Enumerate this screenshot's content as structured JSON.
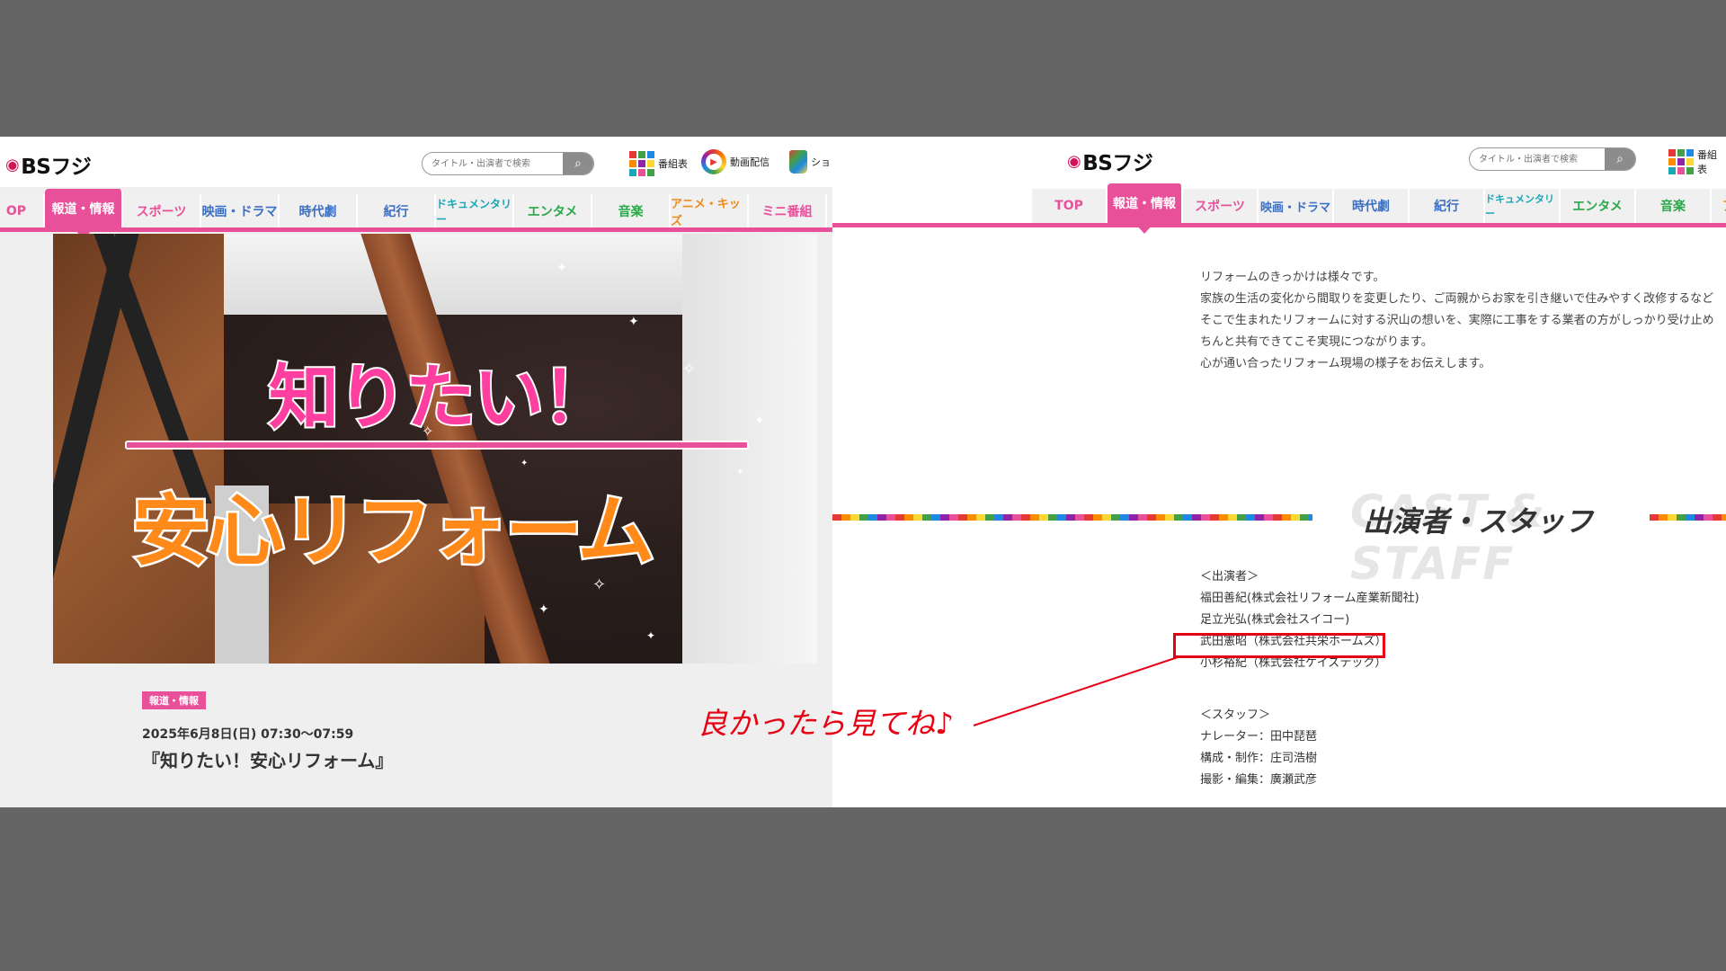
{
  "left": {
    "logo": "BSフジ",
    "search_placeholder": "タイトル・出演者で検索",
    "header_links": [
      "番組表",
      "動画配信",
      "ショ"
    ],
    "nav_tabs": [
      "OP",
      "報道・情報",
      "スポーツ",
      "映画・ドラマ",
      "時代劇",
      "紀行",
      "ドキュメンタリー",
      "エンタメ",
      "音楽",
      "アニメ・キッズ",
      "ミニ番組"
    ],
    "nav_colors": [
      "#e8519a",
      "#ffffff",
      "#e8519a",
      "#3b6fc4",
      "#3b6fc4",
      "#3b6fc4",
      "#1aa6b7",
      "#2aa84a",
      "#2aa84a",
      "#f08a1c",
      "#e8519a"
    ],
    "hero_title_1": "知りたい！",
    "hero_title_2": "安心リフォーム",
    "category_badge": "報道・情報",
    "air_date": "2025年6月8日(日) 07:30〜07:59",
    "program_title": "『知りたい！安心リフォーム』"
  },
  "right": {
    "logo": "BSフジ",
    "search_placeholder": "タイトル・出演者で検索",
    "header_link": "番組表",
    "nav_tabs": [
      "TOP",
      "報道・情報",
      "スポーツ",
      "映画・ドラマ",
      "時代劇",
      "紀行",
      "ドキュメンタリー",
      "エンタメ",
      "音楽",
      "ア"
    ],
    "nav_colors": [
      "#e8519a",
      "#ffffff",
      "#e8519a",
      "#3b6fc4",
      "#3b6fc4",
      "#3b6fc4",
      "#1aa6b7",
      "#2aa84a",
      "#2aa84a",
      "#f08a1c"
    ],
    "description": [
      "リフォームのきっかけは様々です。",
      "家族の生活の変化から間取りを変更したり、ご両親からお家を引き継いで住みやすく改修するなど",
      "そこで生まれたリフォームに対する沢山の想いを、実際に工事をする業者の方がしっかり受け止め",
      "ちんと共有できてこそ実現につながります。",
      "心が通い合ったリフォーム現場の様子をお伝えします。"
    ],
    "section_bg_word": "CAST & STAFF",
    "section_title": "出演者・スタッフ",
    "cast_lines": [
      "＜出演者＞",
      "福田善紀(株式会社リフォーム産業新聞社)",
      "足立光弘(株式会社スイコー)",
      "武田憲昭（株式会社共栄ホームズ）",
      "小杉裕紀（株式会社ケイズテック）",
      "",
      "＜スタッフ＞",
      "ナレーター：田中琵琶",
      "構成・制作：庄司浩樹",
      "撮影・編集：廣瀬武彦"
    ]
  },
  "annotation": {
    "note": "良かったら見てね♪",
    "color": "#e60012"
  }
}
